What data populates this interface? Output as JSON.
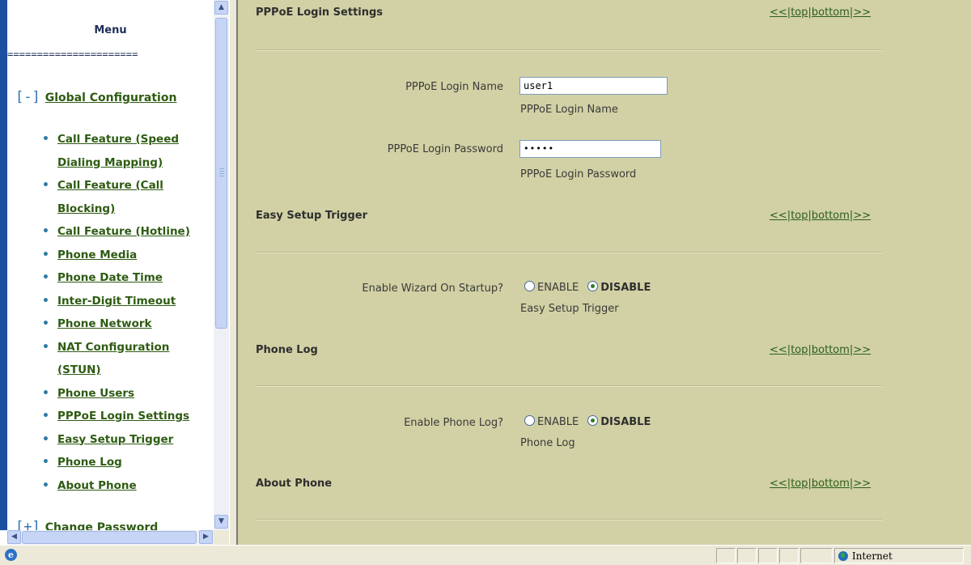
{
  "menu": {
    "title": "Menu",
    "separator": "======================",
    "global_group": {
      "bracket": "[-]",
      "label": "Global Configuration"
    },
    "items": [
      {
        "label": "Call Feature (Speed Dialing Mapping)"
      },
      {
        "label": "Call Feature (Call Blocking)"
      },
      {
        "label": "Call Feature (Hotline)"
      },
      {
        "label": "Phone Media"
      },
      {
        "label": "Phone Date Time"
      },
      {
        "label": "Inter-Digit Timeout"
      },
      {
        "label": "Phone Network"
      },
      {
        "label": "NAT Configuration (STUN)"
      },
      {
        "label": "Phone Users"
      },
      {
        "label": "PPPoE Login Settings"
      },
      {
        "label": "Easy Setup Trigger"
      },
      {
        "label": "Phone Log"
      },
      {
        "label": "About Phone"
      }
    ],
    "next_group": {
      "bracket": "[+]",
      "label": "Change Password"
    }
  },
  "nav": {
    "prev": "<<",
    "top": "top",
    "bottom": "bottom",
    "next": ">>",
    "sep": "|"
  },
  "sections": {
    "pppoe": {
      "title": "PPPoE Login Settings",
      "login_name_label": "PPPoE Login Name",
      "login_name_value": "user1",
      "login_name_hint": "PPPoE Login Name",
      "password_label": "PPPoE Login Password",
      "password_value": "•••••",
      "password_hint": "PPPoE Login Password"
    },
    "easy_setup": {
      "title": "Easy Setup Trigger",
      "field_label": "Enable Wizard On Startup?",
      "opt_enable": "ENABLE",
      "opt_disable": "DISABLE",
      "selected": "DISABLE",
      "hint": "Easy Setup Trigger"
    },
    "phone_log": {
      "title": "Phone Log",
      "field_label": "Enable Phone Log?",
      "opt_enable": "ENABLE",
      "opt_disable": "DISABLE",
      "selected": "DISABLE",
      "hint": "Phone Log"
    },
    "about": {
      "title": "About Phone"
    }
  },
  "statusbar": {
    "zone": "Internet",
    "ie_icon": "ie-page-icon",
    "globe_icon": "globe-icon"
  },
  "colors": {
    "content_bg": "#d1d1a5",
    "link_green": "#2e5b12",
    "accent_blue": "#1c4fa0"
  }
}
